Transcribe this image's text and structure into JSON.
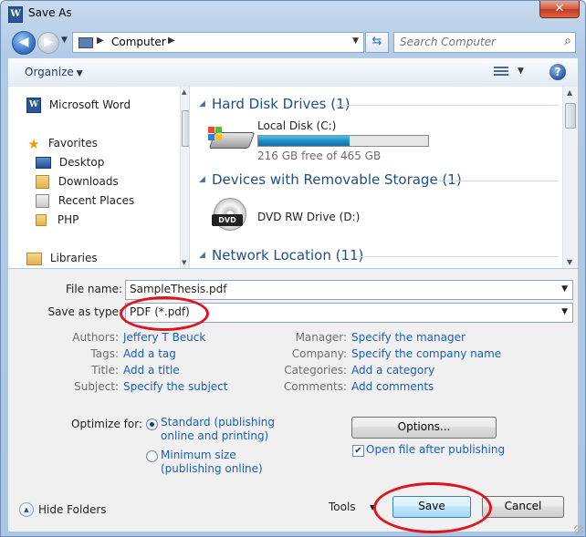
{
  "window": {
    "title": "Save As",
    "app_icon_letter": "W",
    "close_glyph": "✕"
  },
  "nav": {
    "back_glyph": "◀",
    "forward_glyph": "▶",
    "address": {
      "crumbs": [
        "Computer"
      ]
    },
    "search_placeholder": "Search Computer"
  },
  "toolbar": {
    "organize_label": "Organize"
  },
  "nav_pane": {
    "items": [
      {
        "label": "Microsoft Word",
        "icon": "word-icon"
      },
      {
        "label": "Favorites",
        "icon": "star-icon"
      },
      {
        "label": "Desktop",
        "icon": "desktop-icon"
      },
      {
        "label": "Downloads",
        "icon": "downloads-icon"
      },
      {
        "label": "Recent Places",
        "icon": "recent-places-icon"
      },
      {
        "label": "PHP",
        "icon": "folder-icon"
      },
      {
        "label": "Libraries",
        "icon": "libraries-icon"
      }
    ]
  },
  "content": {
    "groups": [
      {
        "label": "Hard Disk Drives (1)"
      },
      {
        "label": "Devices with Removable Storage (1)"
      },
      {
        "label": "Network Location (11)"
      }
    ],
    "local_disk": {
      "name": "Local Disk (C:)",
      "free": "216 GB free of 465 GB",
      "used_fraction": 0.54
    },
    "dvd": {
      "name": "DVD RW Drive (D:)",
      "badge": "DVD"
    }
  },
  "form": {
    "file_name_label": "File name:",
    "file_name_value": "SampleThesis.pdf",
    "save_type_label": "Save as type:",
    "save_type_value": "PDF (*.pdf)"
  },
  "meta": {
    "authors_label": "Authors:",
    "authors_value": "Jeffery T Beuck",
    "tags_label": "Tags:",
    "tags_value": "Add a tag",
    "title_label": "Title:",
    "title_value": "Add a title",
    "subject_label": "Subject:",
    "subject_value": "Specify the subject",
    "manager_label": "Manager:",
    "manager_value": "Specify the manager",
    "company_label": "Company:",
    "company_value": "Specify the company name",
    "categories_label": "Categories:",
    "categories_value": "Add a category",
    "comments_label": "Comments:",
    "comments_value": "Add comments"
  },
  "optimize": {
    "label": "Optimize for:",
    "standard_line1": "Standard (publishing",
    "standard_line2": "online and printing)",
    "minimum_line1": "Minimum size",
    "minimum_line2": "(publishing online)",
    "selected": "standard"
  },
  "options": {
    "button": "Options...",
    "open_after_label": "Open file after publishing",
    "open_after_checked": true
  },
  "footer": {
    "hide_folders": "Hide Folders",
    "tools": "Tools",
    "save": "Save",
    "cancel": "Cancel"
  },
  "colors": {
    "annotation": "#e0141e",
    "link": "#1a5fb4",
    "group_header": "#1e4f8a"
  }
}
